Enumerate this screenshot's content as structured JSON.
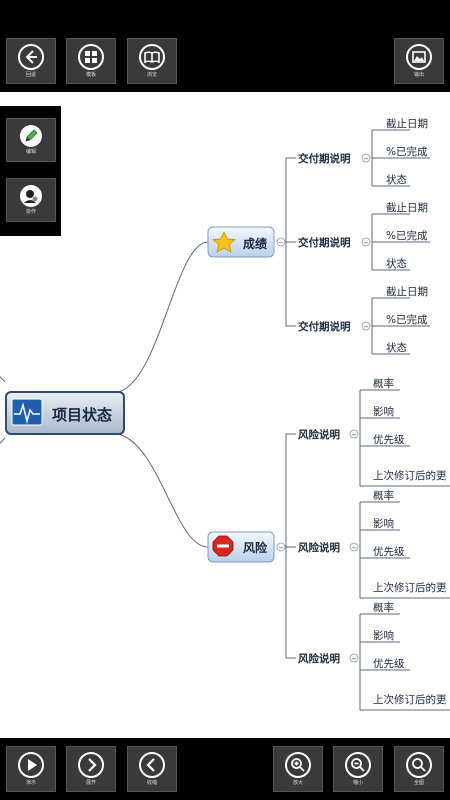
{
  "toolbar_top": {
    "back_label": "回退",
    "template_label": "模板",
    "browse_label": "浏览",
    "export_label": "输出"
  },
  "side_panel": {
    "edit_label": "编辑",
    "collab_label": "协作"
  },
  "toolbar_bottom": {
    "present_label": "演示",
    "expand_label": "展开",
    "collapse_label": "收缩",
    "zoom_in_label": "放大",
    "zoom_out_label": "缩小",
    "fit_label": "全图"
  },
  "mindmap": {
    "root": "项目状态",
    "branch_score": "成绩",
    "branch_risk": "风险",
    "deliverable": "交付期说明",
    "deliverable_children": [
      "截止日期",
      "%已完成",
      "状态"
    ],
    "risk": "风险说明",
    "risk_children": [
      "概率",
      "影响",
      "优先级",
      "上次修订后的更"
    ],
    "collapse_glyph": "−"
  },
  "colors": {
    "bar_bg": "#000000",
    "button_bg": "#3a3a3a",
    "node_blue": "#cfe0f3",
    "line": "#5a6a7c",
    "root_dark": "#2e4a70"
  }
}
